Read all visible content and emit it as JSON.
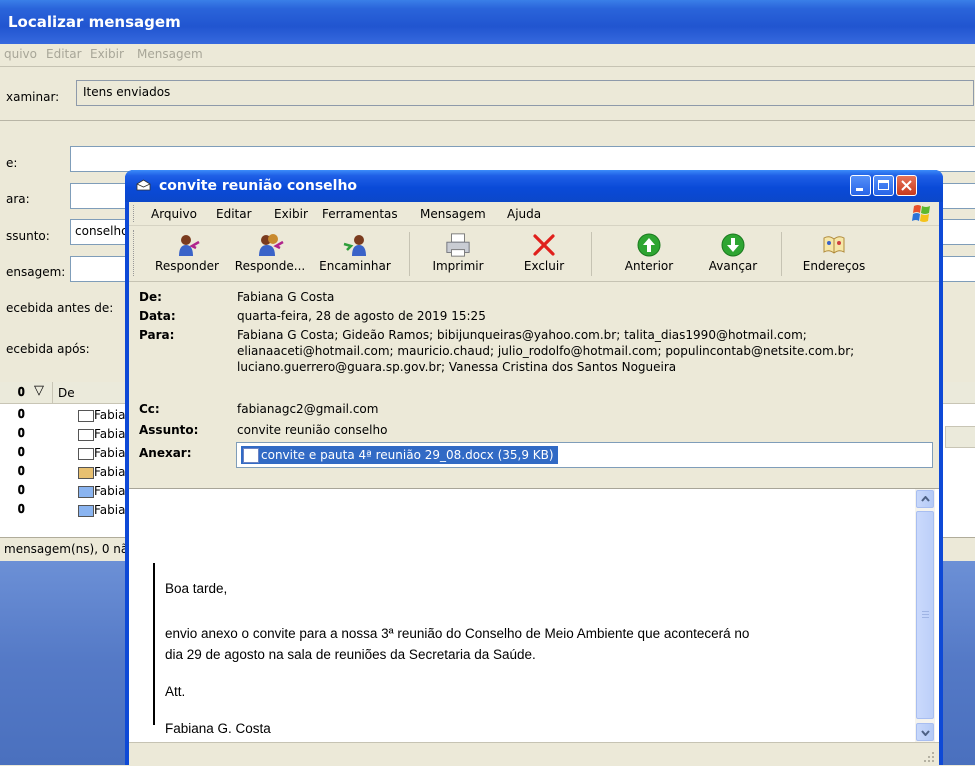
{
  "background_window": {
    "title": "Localizar mensagem",
    "menu": [
      "quivo",
      "Editar",
      "Exibir",
      "Mensagem"
    ],
    "look_in_label": "xaminar:",
    "look_in_value": "Itens enviados",
    "fields": [
      {
        "label": "e:",
        "value": ""
      },
      {
        "label": "ara:",
        "value": ""
      },
      {
        "label": "ssunto:",
        "value": "conselho"
      },
      {
        "label": "ensagem:",
        "value": ""
      }
    ],
    "received_before_label": "ecebida antes de:",
    "received_after_label": "ecebida após:",
    "list_header_from": "De",
    "list_rows": [
      "Fabia",
      "Fabia",
      "Fabia",
      "Fabia",
      "Fabia",
      "Fabia"
    ],
    "status": "mensagem(ns), 0 nã"
  },
  "message_window": {
    "title": "convite reunião conselho",
    "menu": [
      "Arquivo",
      "Editar",
      "Exibir",
      "Ferramentas",
      "Mensagem",
      "Ajuda"
    ],
    "toolbar": {
      "reply": "Responder",
      "reply_all": "Responde...",
      "forward": "Encaminhar",
      "print": "Imprimir",
      "delete": "Excluir",
      "previous": "Anterior",
      "next": "Avançar",
      "addresses": "Endereços"
    },
    "header": {
      "from_label": "De:",
      "from": "Fabiana G Costa",
      "date_label": "Data:",
      "date": "quarta-feira, 28 de agosto de 2019 15:25",
      "to_label": "Para:",
      "to_line1": "Fabiana G Costa; Gideão Ramos; bibijunqueiras@yahoo.com.br; talita_dias1990@hotmail.com;",
      "to_line2": "elianaaceti@hotmail.com; mauricio.chaud; julio_rodolfo@hotmail.com; populincontab@netsite.com.br;",
      "to_line3": "luciano.guerrero@guara.sp.gov.br; Vanessa Cristina dos Santos Nogueira",
      "cc_label": "Cc:",
      "cc": "fabianagc2@gmail.com",
      "subject_label": "Assunto:",
      "subject": "convite reunião conselho",
      "attach_label": "Anexar:",
      "attachment": "convite e pauta 4ª reunião 29_08.docx (35,9 KB)"
    },
    "body": {
      "greeting": "Boa tarde,",
      "line1": "envio anexo o convite para a nossa 3ª reunião do Conselho de Meio Ambiente que acontecerá no",
      "line2": "dia 29 de agosto na sala de reuniões da  Secretaria da Saúde.",
      "closing": "Att.",
      "signature": "Fabiana G. Costa"
    }
  },
  "colors": {
    "xp_blue": "#0E49D6",
    "window_face": "#ECE9D8",
    "selection": "#316AC5",
    "close_red": "#C8391D"
  }
}
